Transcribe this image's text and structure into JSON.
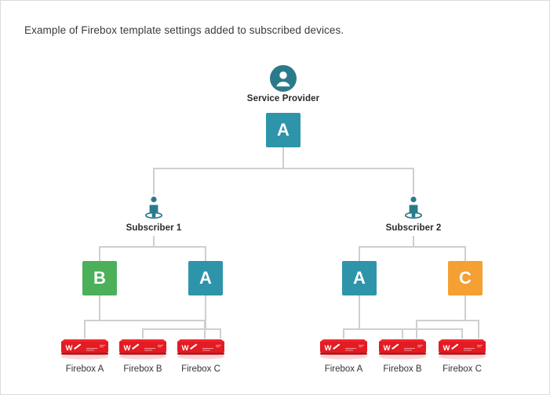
{
  "page": {
    "caption": "Example of Firebox template settings added to subscribed devices.",
    "background_color": "#ffffff",
    "border_color": "#dcdcdc"
  },
  "colors": {
    "teal": "#2e94aa",
    "green": "#4cb05a",
    "orange": "#f5a033",
    "device_red": "#e31b23",
    "connector_gray": "#cfcfcf",
    "icon_teal": "#2b7a8c",
    "text_dark": "#2a2a2a"
  },
  "service_provider": {
    "label": "Service Provider",
    "icon": "user-circle-icon",
    "template": {
      "label": "A",
      "color": "#2e94aa"
    }
  },
  "subscribers": [
    {
      "label": "Subscriber 1",
      "icon": "user-standing-icon",
      "templates": [
        {
          "label": "B",
          "color": "#4cb05a"
        },
        {
          "label": "A",
          "color": "#2e94aa"
        }
      ],
      "devices": [
        {
          "label": "Firebox A",
          "icon": "firebox-appliance-icon"
        },
        {
          "label": "Firebox B",
          "icon": "firebox-appliance-icon"
        },
        {
          "label": "Firebox C",
          "icon": "firebox-appliance-icon"
        }
      ]
    },
    {
      "label": "Subscriber 2",
      "icon": "user-standing-icon",
      "templates": [
        {
          "label": "A",
          "color": "#2e94aa"
        },
        {
          "label": "C",
          "color": "#f5a033"
        }
      ],
      "devices": [
        {
          "label": "Firebox A",
          "icon": "firebox-appliance-icon"
        },
        {
          "label": "Firebox B",
          "icon": "firebox-appliance-icon"
        },
        {
          "label": "Firebox C",
          "icon": "firebox-appliance-icon"
        }
      ]
    }
  ]
}
